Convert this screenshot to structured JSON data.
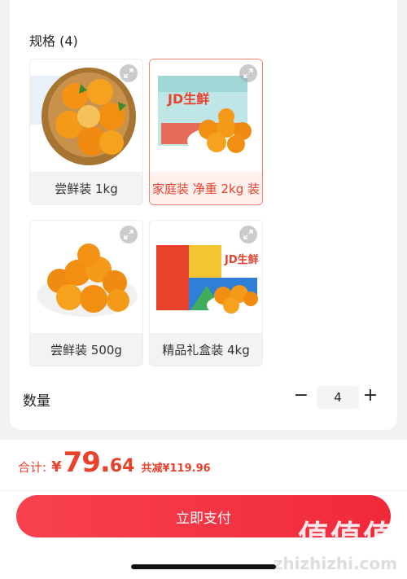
{
  "spec": {
    "title": "规格 (4)",
    "options": [
      {
        "label": "尝鲜装 1kg",
        "selected": false,
        "image": "orange-basket"
      },
      {
        "label": "家庭装 净重 2kg 装",
        "selected": true,
        "image": "gift-box-jd-fresh"
      },
      {
        "label": "尝鲜装 500g",
        "selected": false,
        "image": "orange-plate"
      },
      {
        "label": "精品礼盒装 4kg",
        "selected": false,
        "image": "colorful-gift-box"
      }
    ]
  },
  "quantity": {
    "label": "数量",
    "minus": "−",
    "value": "4",
    "plus": "+"
  },
  "summary": {
    "total_label": "合计:",
    "currency": "¥",
    "price_int": "79.",
    "price_dec": "64",
    "saving": "共减¥119.96"
  },
  "pay_button": {
    "label": "立即支付"
  },
  "watermark": {
    "text": "值值值",
    "url": "zhizhizhi.com"
  },
  "colors": {
    "accent": "#e8412c",
    "button": "#f1293a"
  }
}
